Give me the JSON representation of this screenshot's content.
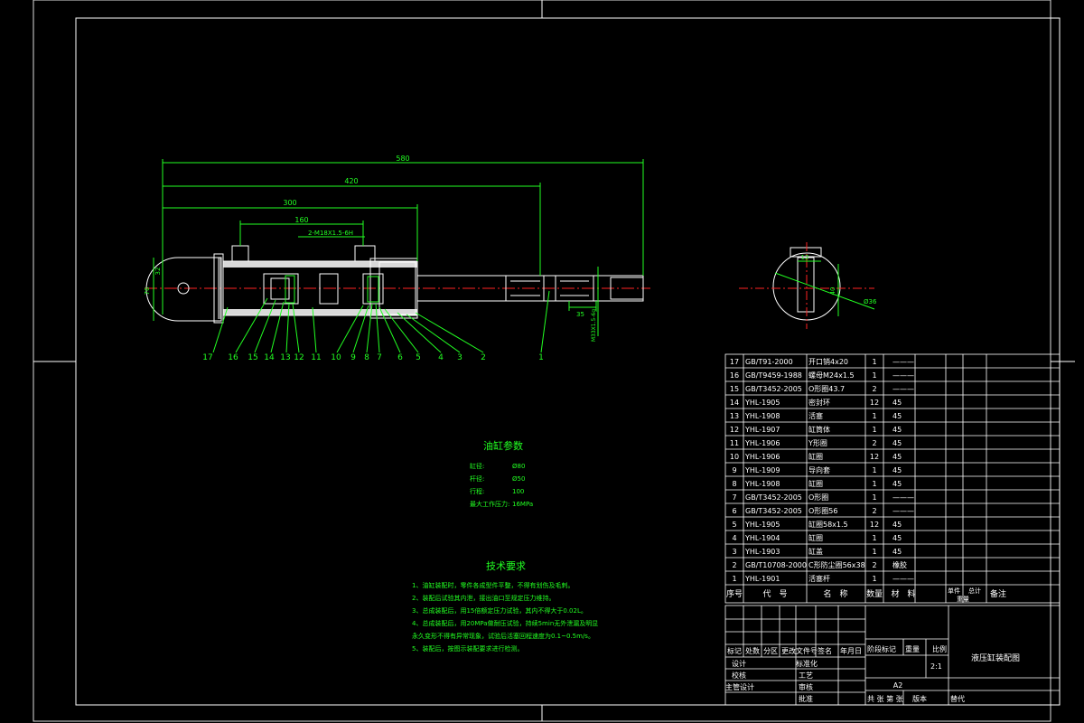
{
  "dimensions": {
    "overall": "580",
    "d420": "420",
    "d300": "300",
    "d160": "160",
    "ports": "2-M18X1.5-6H",
    "d76": "76",
    "d32": "32",
    "d35": "35",
    "rod_thread": "M33X1.5-6g"
  },
  "section_labels": {
    "width": "12",
    "depth": "40",
    "dia": "Ø36"
  },
  "callouts": [
    "17",
    "16",
    "15",
    "14",
    "13",
    "12",
    "11",
    "10",
    "9",
    "8",
    "7",
    "6",
    "5",
    "4",
    "3",
    "2",
    "1"
  ],
  "params": {
    "title": "油缸参数",
    "rows": [
      {
        "label": "缸径:",
        "value": "Ø80"
      },
      {
        "label": "杆径:",
        "value": "Ø50"
      },
      {
        "label": "行程:",
        "value": "100"
      },
      {
        "label": "最大工作压力:",
        "value": "16MPa"
      }
    ]
  },
  "tech": {
    "title": "技术要求",
    "items": [
      "1、油缸装配时，零件各成型件平整，不得有划伤及毛刺。",
      "2、装配后试验其内泄，接出油口至规定压力维持。",
      "3、总成装配后，用15倍额定压力试验，其内不得大于0.02L。",
      "4、总成装配后，用20MPa做耐压试验，持续5min无外泄漏及明显",
      "   永久变形不得有异常现象，试验后活塞回程速度为0.1~0.5m/s。",
      "5、装配后，按图示装配要求进行检测。"
    ]
  },
  "bom": {
    "rows": [
      {
        "no": "17",
        "code": "GB/T91-2000",
        "name": "开口销4x20",
        "qty": "1",
        "mat": "———"
      },
      {
        "no": "16",
        "code": "GB/T9459-1988",
        "name": "螺母M24x1.5",
        "qty": "1",
        "mat": "———"
      },
      {
        "no": "15",
        "code": "GB/T3452-2005",
        "name": "O形圈43.7",
        "qty": "2",
        "mat": "———"
      },
      {
        "no": "14",
        "code": "YHL-1905",
        "name": "密封环",
        "qty": "12",
        "mat": "45"
      },
      {
        "no": "13",
        "code": "YHL-1908",
        "name": "活塞",
        "qty": "1",
        "mat": "45"
      },
      {
        "no": "12",
        "code": "YHL-1907",
        "name": "缸筒体",
        "qty": "1",
        "mat": "45"
      },
      {
        "no": "11",
        "code": "YHL-1906",
        "name": "Y形圈",
        "qty": "2",
        "mat": "45"
      },
      {
        "no": "10",
        "code": "YHL-1906",
        "name": "缸圈",
        "qty": "12",
        "mat": "45"
      },
      {
        "no": "9",
        "code": "YHL-1909",
        "name": "导向套",
        "qty": "1",
        "mat": "45"
      },
      {
        "no": "8",
        "code": "YHL-1908",
        "name": "缸圈",
        "qty": "1",
        "mat": "45"
      },
      {
        "no": "7",
        "code": "GB/T3452-2005",
        "name": "O形圈",
        "qty": "1",
        "mat": "———"
      },
      {
        "no": "6",
        "code": "GB/T3452-2005",
        "name": "O形圈56",
        "qty": "2",
        "mat": "———"
      },
      {
        "no": "5",
        "code": "YHL-1905",
        "name": "缸圈58x1.5",
        "qty": "12",
        "mat": "45"
      },
      {
        "no": "4",
        "code": "YHL-1904",
        "name": "缸圈",
        "qty": "1",
        "mat": "45"
      },
      {
        "no": "3",
        "code": "YHL-1903",
        "name": "缸盖",
        "qty": "1",
        "mat": "45"
      },
      {
        "no": "2",
        "code": "GB/T10708-2000",
        "name": "C形防尘圈56x38",
        "qty": "2",
        "mat": "橡胶"
      },
      {
        "no": "1",
        "code": "YHL-1901",
        "name": "活塞杆",
        "qty": "1",
        "mat": "———"
      }
    ],
    "header": {
      "no": "序号",
      "code": "代　号",
      "name": "名　称",
      "qty": "数量",
      "mat": "材　料",
      "single": "单件",
      "total": "总计",
      "weight": "重量",
      "note": "备注"
    }
  },
  "titleblock": {
    "row1": [
      "标记",
      "处数",
      "分区",
      "更改文件号",
      "签名",
      "年月日"
    ],
    "design": "设计",
    "std": "标准化",
    "check": "校核",
    "craft": "工艺",
    "chief": "主管设计",
    "review": "审核",
    "approve": "批准",
    "stage_hdr": "阶段标记",
    "weight_hdr": "重量",
    "scale_hdr": "比例",
    "scale": "2:1",
    "drawing_title": "液压缸装配图",
    "sheet": "A2",
    "total_sheets": "共 张 第 张",
    "version": "版本",
    "replace": "替代"
  }
}
